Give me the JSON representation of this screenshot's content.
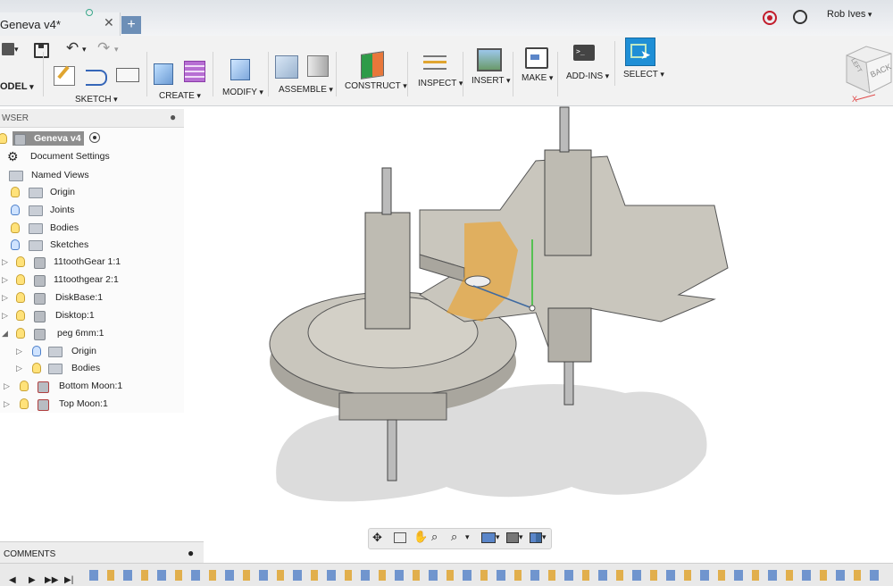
{
  "window": {
    "tab_title": "Geneva v4*",
    "new_tab_symbol": "+",
    "user_name": "Rob Ives"
  },
  "toolbar": {
    "workspace": "ODEL",
    "groups": [
      {
        "label": "SKETCH"
      },
      {
        "label": "CREATE"
      },
      {
        "label": "MODIFY"
      },
      {
        "label": "ASSEMBLE"
      },
      {
        "label": "CONSTRUCT"
      },
      {
        "label": "INSPECT"
      },
      {
        "label": "INSERT"
      },
      {
        "label": "MAKE"
      },
      {
        "label": "ADD-INS"
      },
      {
        "label": "SELECT"
      }
    ]
  },
  "browser": {
    "header": "WSER",
    "root": "Geneva v4",
    "items": [
      {
        "label": "Document Settings"
      },
      {
        "label": "Named Views"
      },
      {
        "label": "Origin"
      },
      {
        "label": "Joints"
      },
      {
        "label": "Bodies"
      },
      {
        "label": "Sketches"
      },
      {
        "label": "11toothGear 1:1"
      },
      {
        "label": "11toothgear 2:1"
      },
      {
        "label": "DiskBase:1"
      },
      {
        "label": "Disktop:1"
      },
      {
        "label": "peg 6mm:1"
      },
      {
        "label": "Origin"
      },
      {
        "label": "Bodies"
      },
      {
        "label": "Bottom Moon:1"
      },
      {
        "label": "Top Moon:1"
      }
    ]
  },
  "comments": {
    "label": "COMMENTS"
  },
  "viewcube": {
    "face_front": "LEFT",
    "face_back": "BACK",
    "axis_label": "X"
  },
  "colors": {
    "accent": "#1f8fd6",
    "tab_accent": "#6d8fb7",
    "model_body": "#c9c6bd",
    "selection": "#f0a020"
  }
}
